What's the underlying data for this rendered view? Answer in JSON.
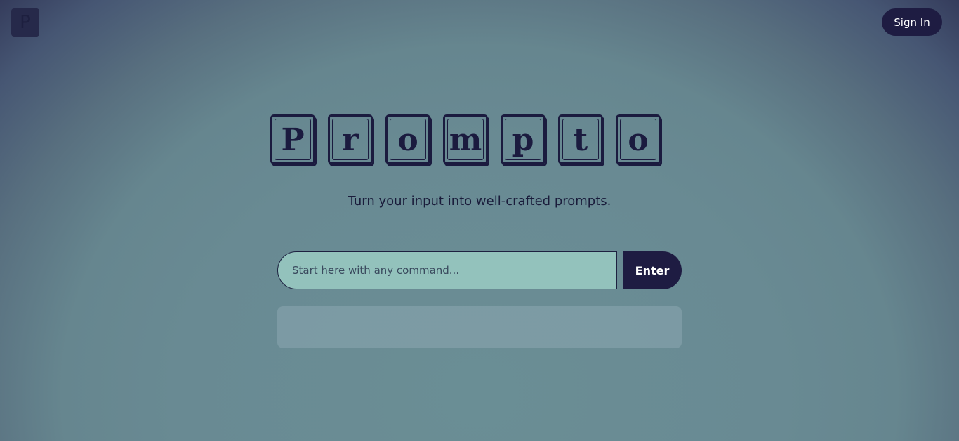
{
  "header": {
    "logo_letter": "P",
    "signin_label": "Sign In"
  },
  "hero": {
    "title_letters": [
      "P",
      "r",
      "o",
      "m",
      "p",
      "t",
      "o"
    ],
    "tagline": "Turn your input into well-crafted prompts."
  },
  "command": {
    "placeholder": "Start here with any command...",
    "value": "",
    "enter_label": "Enter"
  },
  "output": {
    "text": ""
  },
  "colors": {
    "accent_dark": "#1e1c42",
    "input_bg": "#93c2bc",
    "tile_ink": "#1b1b3f"
  }
}
